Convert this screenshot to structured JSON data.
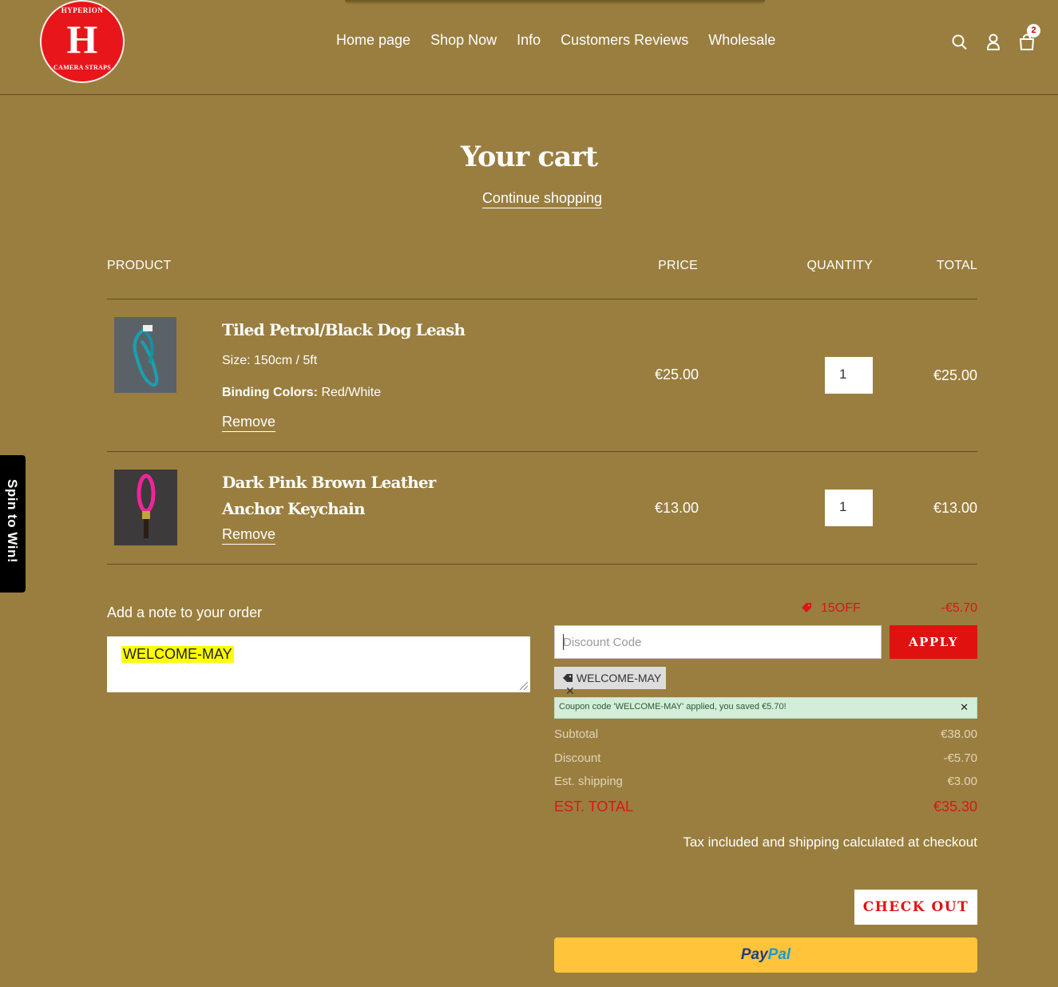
{
  "header": {
    "logo": {
      "top_text": "HYPERION",
      "monogram": "H",
      "bottom_text": "CAMERA STRAPS"
    },
    "nav": [
      "Home page",
      "Shop Now",
      "Info",
      "Customers Reviews",
      "Wholesale"
    ],
    "icons": [
      "search-icon",
      "account-icon",
      "cart-icon"
    ],
    "cart_count": "2"
  },
  "page": {
    "title": "Your cart",
    "continue_label": "Continue shopping"
  },
  "table": {
    "headers": {
      "product": "PRODUCT",
      "price": "PRICE",
      "quantity": "QUANTITY",
      "total": "TOTAL"
    },
    "items": [
      {
        "title": "Tiled Petrol/Black Dog Leash",
        "size": "Size: 150cm / 5ft",
        "binding_label": "Binding Colors:",
        "binding_value": "Red/White",
        "remove": "Remove",
        "price": "€25.00",
        "quantity": "1",
        "total": "€25.00"
      },
      {
        "title_line1": "Dark Pink Brown Leather",
        "title_line2": "Anchor Keychain",
        "remove": "Remove",
        "price": "€13.00",
        "quantity": "1",
        "total": "€13.00"
      }
    ]
  },
  "note": {
    "label": "Add a note to your order",
    "value": "WELCOME-MAY"
  },
  "discount": {
    "tag_label": "15OFF",
    "tag_amount": "-€5.70",
    "placeholder": "Discount Code",
    "apply": "APPLY",
    "chip": "WELCOME-MAY",
    "success": "Coupon code 'WELCOME-MAY' applied, you saved €5.70!"
  },
  "summary": {
    "subtotal_label": "Subtotal",
    "subtotal": "€38.00",
    "discount_label": "Discount",
    "discount": "-€5.70",
    "shipping_label": "Est. shipping",
    "shipping": "€3.00",
    "total_label": "EST. TOTAL",
    "total": "€35.30"
  },
  "tax_note": "Tax included and shipping calculated at checkout",
  "checkout": "CHECK OUT",
  "paypal": {
    "part1": "Pay",
    "part2": "Pal"
  },
  "spin": "Spin to Win!",
  "colors": {
    "background": "#9a7e3f",
    "accent_red": "#e0120f",
    "paypal": "#ffc439"
  }
}
